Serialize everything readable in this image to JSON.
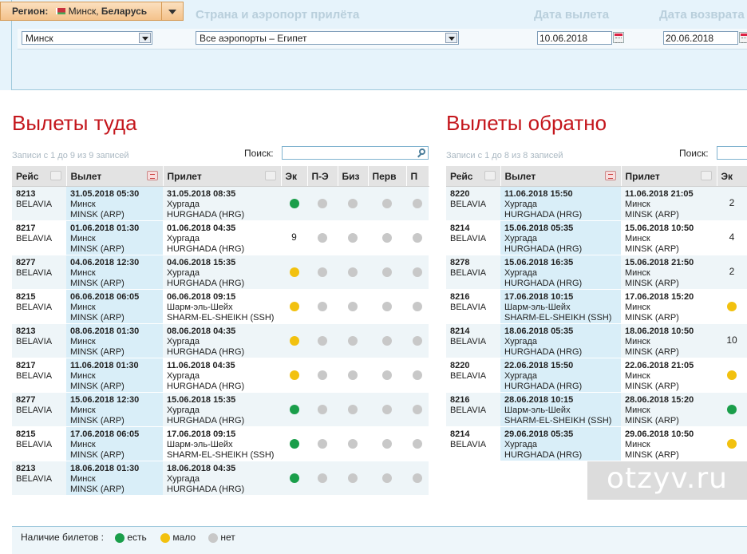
{
  "header": {
    "region_label": "Регион:",
    "region_city": "Минск, ",
    "region_country": "Беларусь",
    "col_arrival": "Страна и аэропорт прилёта",
    "col_departure_date": "Дата вылета",
    "col_return_date": "Дата возврата"
  },
  "form": {
    "departure_city": "Минск",
    "destination": "Все аэропорты – Египет",
    "departure_date": "10.06.2018",
    "return_date": "20.06.2018"
  },
  "outbound": {
    "title": "Вылеты туда",
    "info": "Записи с 1 до 9 из 9 записей",
    "search_label": "Поиск:",
    "columns": [
      "Рейс",
      "Вылет",
      "Прилет",
      "Эк",
      "П-Э",
      "Биз",
      "Перв",
      "П"
    ],
    "rows": [
      {
        "flight": "8213",
        "airline": "BELAVIA",
        "dep_dt": "31.05.2018 05:30",
        "dep_city": "Минск",
        "dep_code": "MINSK (ARP)",
        "arr_dt": "31.05.2018 08:35",
        "arr_city": "Хургада",
        "arr_code": "HURGHADA (HRG)",
        "ek": "g",
        "ek_count": ""
      },
      {
        "flight": "8217",
        "airline": "BELAVIA",
        "dep_dt": "01.06.2018 01:30",
        "dep_city": "Минск",
        "dep_code": "MINSK (ARP)",
        "arr_dt": "01.06.2018 04:35",
        "arr_city": "Хургада",
        "arr_code": "HURGHADA (HRG)",
        "ek": "",
        "ek_count": "9"
      },
      {
        "flight": "8277",
        "airline": "BELAVIA",
        "dep_dt": "04.06.2018 12:30",
        "dep_city": "Минск",
        "dep_code": "MINSK (ARP)",
        "arr_dt": "04.06.2018 15:35",
        "arr_city": "Хургада",
        "arr_code": "HURGHADA (HRG)",
        "ek": "y",
        "ek_count": ""
      },
      {
        "flight": "8215",
        "airline": "BELAVIA",
        "dep_dt": "06.06.2018 06:05",
        "dep_city": "Минск",
        "dep_code": "MINSK (ARP)",
        "arr_dt": "06.06.2018 09:15",
        "arr_city": "Шарм-эль-Шейх",
        "arr_code": "SHARM-EL-SHEIKH (SSH)",
        "ek": "y",
        "ek_count": ""
      },
      {
        "flight": "8213",
        "airline": "BELAVIA",
        "dep_dt": "08.06.2018 01:30",
        "dep_city": "Минск",
        "dep_code": "MINSK (ARP)",
        "arr_dt": "08.06.2018 04:35",
        "arr_city": "Хургада",
        "arr_code": "HURGHADA (HRG)",
        "ek": "y",
        "ek_count": ""
      },
      {
        "flight": "8217",
        "airline": "BELAVIA",
        "dep_dt": "11.06.2018 01:30",
        "dep_city": "Минск",
        "dep_code": "MINSK (ARP)",
        "arr_dt": "11.06.2018 04:35",
        "arr_city": "Хургада",
        "arr_code": "HURGHADA (HRG)",
        "ek": "y",
        "ek_count": ""
      },
      {
        "flight": "8277",
        "airline": "BELAVIA",
        "dep_dt": "15.06.2018 12:30",
        "dep_city": "Минск",
        "dep_code": "MINSK (ARP)",
        "arr_dt": "15.06.2018 15:35",
        "arr_city": "Хургада",
        "arr_code": "HURGHADA (HRG)",
        "ek": "g",
        "ek_count": ""
      },
      {
        "flight": "8215",
        "airline": "BELAVIA",
        "dep_dt": "17.06.2018 06:05",
        "dep_city": "Минск",
        "dep_code": "MINSK (ARP)",
        "arr_dt": "17.06.2018 09:15",
        "arr_city": "Шарм-эль-Шейх",
        "arr_code": "SHARM-EL-SHEIKH (SSH)",
        "ek": "g",
        "ek_count": ""
      },
      {
        "flight": "8213",
        "airline": "BELAVIA",
        "dep_dt": "18.06.2018 01:30",
        "dep_city": "Минск",
        "dep_code": "MINSK (ARP)",
        "arr_dt": "18.06.2018 04:35",
        "arr_city": "Хургада",
        "arr_code": "HURGHADA (HRG)",
        "ek": "g",
        "ek_count": ""
      }
    ]
  },
  "inbound": {
    "title": "Вылеты обратно",
    "info": "Записи с 1 до 8 из 8 записей",
    "search_label": "Поиск:",
    "columns": [
      "Рейс",
      "Вылет",
      "Прилет",
      "Эк"
    ],
    "rows": [
      {
        "flight": "8220",
        "airline": "BELAVIA",
        "dep_dt": "11.06.2018 15:50",
        "dep_city": "Хургада",
        "dep_code": "HURGHADA (HRG)",
        "arr_dt": "11.06.2018 21:05",
        "arr_city": "Минск",
        "arr_code": "MINSK (ARP)",
        "ek": "",
        "ek_count": "2"
      },
      {
        "flight": "8214",
        "airline": "BELAVIA",
        "dep_dt": "15.06.2018 05:35",
        "dep_city": "Хургада",
        "dep_code": "HURGHADA (HRG)",
        "arr_dt": "15.06.2018 10:50",
        "arr_city": "Минск",
        "arr_code": "MINSK (ARP)",
        "ek": "",
        "ek_count": "4"
      },
      {
        "flight": "8278",
        "airline": "BELAVIA",
        "dep_dt": "15.06.2018 16:35",
        "dep_city": "Хургада",
        "dep_code": "HURGHADA (HRG)",
        "arr_dt": "15.06.2018 21:50",
        "arr_city": "Минск",
        "arr_code": "MINSK (ARP)",
        "ek": "",
        "ek_count": "2"
      },
      {
        "flight": "8216",
        "airline": "BELAVIA",
        "dep_dt": "17.06.2018 10:15",
        "dep_city": "Шарм-эль-Шейх",
        "dep_code": "SHARM-EL-SHEIKH (SSH)",
        "arr_dt": "17.06.2018 15:20",
        "arr_city": "Минск",
        "arr_code": "MINSK (ARP)",
        "ek": "y",
        "ek_count": ""
      },
      {
        "flight": "8214",
        "airline": "BELAVIA",
        "dep_dt": "18.06.2018 05:35",
        "dep_city": "Хургада",
        "dep_code": "HURGHADA (HRG)",
        "arr_dt": "18.06.2018 10:50",
        "arr_city": "Минск",
        "arr_code": "MINSK (ARP)",
        "ek": "",
        "ek_count": "10"
      },
      {
        "flight": "8220",
        "airline": "BELAVIA",
        "dep_dt": "22.06.2018 15:50",
        "dep_city": "Хургада",
        "dep_code": "HURGHADA (HRG)",
        "arr_dt": "22.06.2018 21:05",
        "arr_city": "Минск",
        "arr_code": "MINSK (ARP)",
        "ek": "y",
        "ek_count": ""
      },
      {
        "flight": "8216",
        "airline": "BELAVIA",
        "dep_dt": "28.06.2018 10:15",
        "dep_city": "Шарм-эль-Шейх",
        "dep_code": "SHARM-EL-SHEIKH (SSH)",
        "arr_dt": "28.06.2018 15:20",
        "arr_city": "Минск",
        "arr_code": "MINSK (ARP)",
        "ek": "g",
        "ek_count": ""
      },
      {
        "flight": "8214",
        "airline": "BELAVIA",
        "dep_dt": "29.06.2018 05:35",
        "dep_city": "Хургада",
        "dep_code": "HURGHADA (HRG)",
        "arr_dt": "29.06.2018 10:50",
        "arr_city": "Минск",
        "arr_code": "MINSK (ARP)",
        "ek": "y",
        "ek_count": ""
      }
    ]
  },
  "legend": {
    "label": "Наличие билетов :",
    "available": "есть",
    "few": "мало",
    "none": "нет"
  },
  "watermark": "otzyv.ru",
  "colors": {
    "available": "#1a9e4a",
    "few": "#f2c10f",
    "none": "#c8c8c8",
    "title_red": "#c4161c"
  }
}
